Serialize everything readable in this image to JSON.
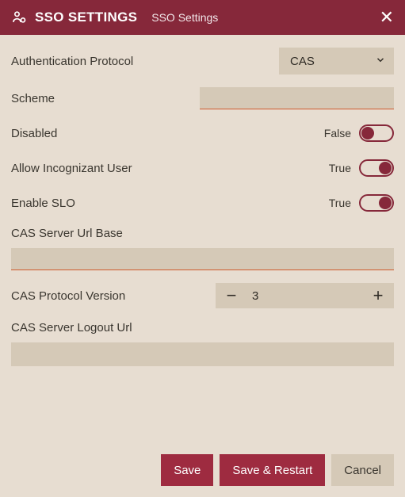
{
  "header": {
    "title": "SSO SETTINGS",
    "subtitle": "SSO Settings"
  },
  "fields": {
    "auth_protocol": {
      "label": "Authentication Protocol",
      "value": "CAS"
    },
    "scheme": {
      "label": "Scheme",
      "value": ""
    },
    "disabled": {
      "label": "Disabled",
      "value_text": "False",
      "on": false
    },
    "allow_incognizant": {
      "label": "Allow Incognizant User",
      "value_text": "True",
      "on": true
    },
    "enable_slo": {
      "label": "Enable SLO",
      "value_text": "True",
      "on": true
    },
    "cas_url_base": {
      "label": "CAS Server Url Base",
      "value": ""
    },
    "cas_protocol_version": {
      "label": "CAS Protocol Version",
      "value": "3"
    },
    "cas_logout_url": {
      "label": "CAS Server Logout Url",
      "value": ""
    }
  },
  "buttons": {
    "save": "Save",
    "save_restart": "Save & Restart",
    "cancel": "Cancel"
  },
  "glyphs": {
    "minus": "−",
    "plus": "+"
  }
}
